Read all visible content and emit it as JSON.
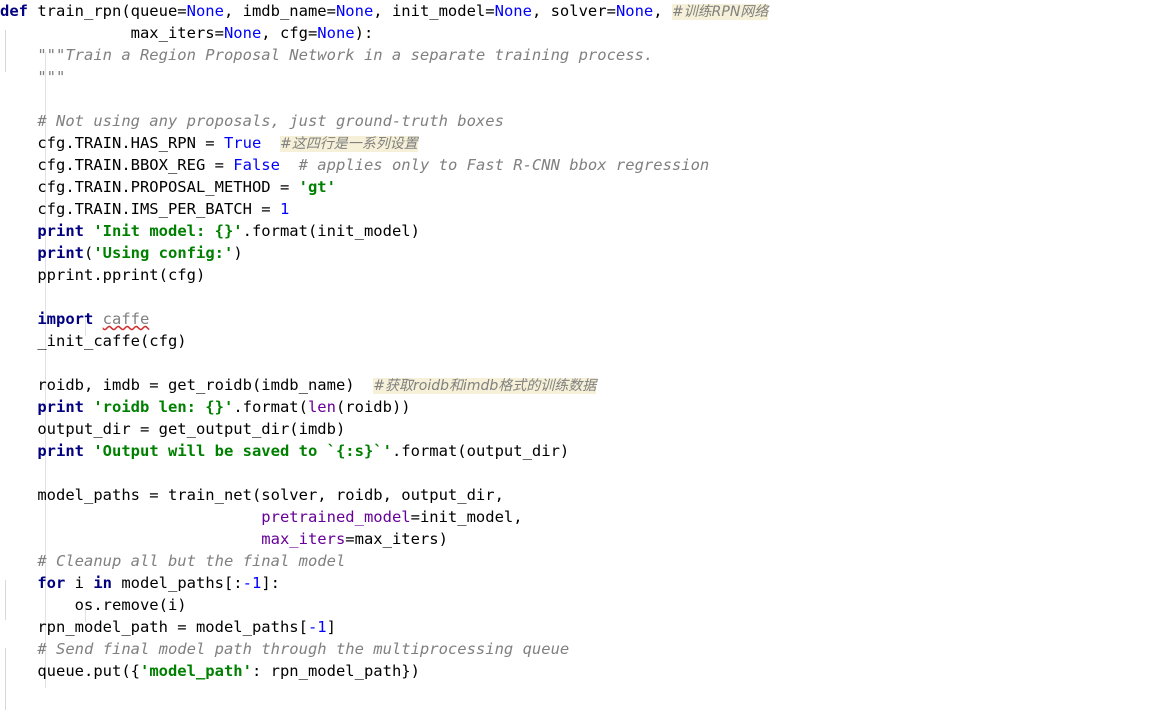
{
  "editor": {
    "language": "Python",
    "font_size_px": 15.5,
    "line_height_px": 22,
    "background": "#ffffff",
    "palette": {
      "default_text": "#000000",
      "keyword": "#000080",
      "number_constant": "#0000ff",
      "string": "#008000",
      "comment": "#808080",
      "keyword_argument": "#660099",
      "builtin": "#660099",
      "annotation_highlight": "#f5f0d7",
      "error_squiggle": "#d03030",
      "indent_guide": "#d8d8dc"
    }
  },
  "annotations": [
    {
      "text": "#训练RPN网络",
      "line": 1
    },
    {
      "text": "#这四行是一系列设置",
      "line": 8
    },
    {
      "text": "#获取roidb和imdb格式的训练数据",
      "line": 19
    }
  ],
  "code": {
    "function_name": "train_rpn",
    "signature_params": [
      "queue=None",
      "imdb_name=None",
      "init_model=None",
      "solver=None",
      "max_iters=None",
      "cfg=None"
    ],
    "docstring": "\"\"\"Train a Region Proposal Network in a separate training process.",
    "docstring_close": "\"\"\"",
    "lines": [
      {
        "n": 1,
        "tokens": [
          {
            "t": "def ",
            "c": "kw"
          },
          {
            "t": "train_rpn(queue=",
            "c": "ident"
          },
          {
            "t": "None",
            "c": "num"
          },
          {
            "t": ", imdb_name=",
            "c": "ident"
          },
          {
            "t": "None",
            "c": "num"
          },
          {
            "t": ", init_model=",
            "c": "ident"
          },
          {
            "t": "None",
            "c": "num"
          },
          {
            "t": ", solver=",
            "c": "ident"
          },
          {
            "t": "None",
            "c": "num"
          },
          {
            "t": ", ",
            "c": "ident"
          },
          {
            "t": "#训练RPN网络",
            "c": "cmt-hl"
          }
        ]
      },
      {
        "n": 2,
        "tokens": [
          {
            "t": "              max_iters=",
            "c": "ident"
          },
          {
            "t": "None",
            "c": "num"
          },
          {
            "t": ", cfg=",
            "c": "ident"
          },
          {
            "t": "None",
            "c": "num"
          },
          {
            "t": "):",
            "c": "ident"
          }
        ]
      },
      {
        "n": 3,
        "tokens": [
          {
            "t": "    \"\"\"Train a Region Proposal Network in a separate training process.",
            "c": "doc"
          }
        ]
      },
      {
        "n": 4,
        "tokens": [
          {
            "t": "    \"\"\"",
            "c": "doc"
          }
        ]
      },
      {
        "n": 5,
        "tokens": [
          {
            "t": "",
            "c": "ident"
          }
        ]
      },
      {
        "n": 6,
        "tokens": [
          {
            "t": "    # Not using any proposals, just ground-truth boxes",
            "c": "cmt"
          }
        ]
      },
      {
        "n": 7,
        "tokens": [
          {
            "t": "    cfg.TRAIN.HAS_RPN = ",
            "c": "ident"
          },
          {
            "t": "True",
            "c": "num"
          },
          {
            "t": "  ",
            "c": "ident"
          },
          {
            "t": "#这四行是一系列设置",
            "c": "cmt-hl"
          }
        ]
      },
      {
        "n": 8,
        "tokens": [
          {
            "t": "    cfg.TRAIN.BBOX_REG = ",
            "c": "ident"
          },
          {
            "t": "False",
            "c": "num"
          },
          {
            "t": "  ",
            "c": "ident"
          },
          {
            "t": "# applies only to Fast R-CNN bbox regression",
            "c": "cmt"
          }
        ]
      },
      {
        "n": 9,
        "tokens": [
          {
            "t": "    cfg.TRAIN.PROPOSAL_METHOD = ",
            "c": "ident"
          },
          {
            "t": "'gt'",
            "c": "str"
          }
        ]
      },
      {
        "n": 10,
        "tokens": [
          {
            "t": "    cfg.TRAIN.IMS_PER_BATCH = ",
            "c": "ident"
          },
          {
            "t": "1",
            "c": "num"
          }
        ]
      },
      {
        "n": 11,
        "tokens": [
          {
            "t": "    print ",
            "c": "kw"
          },
          {
            "t": "'Init model: {}'",
            "c": "str"
          },
          {
            "t": ".format(init_model)",
            "c": "ident"
          }
        ]
      },
      {
        "n": 12,
        "tokens": [
          {
            "t": "    print",
            "c": "kw"
          },
          {
            "t": "(",
            "c": "ident"
          },
          {
            "t": "'Using config:'",
            "c": "str"
          },
          {
            "t": ")",
            "c": "ident"
          }
        ]
      },
      {
        "n": 13,
        "tokens": [
          {
            "t": "    pprint.pprint(cfg)",
            "c": "ident"
          }
        ]
      },
      {
        "n": 14,
        "tokens": [
          {
            "t": "",
            "c": "ident"
          }
        ]
      },
      {
        "n": 15,
        "tokens": [
          {
            "t": "    import ",
            "c": "kw-import"
          },
          {
            "t": "caffe",
            "c": "unresolved"
          }
        ]
      },
      {
        "n": 16,
        "tokens": [
          {
            "t": "    _init_caffe(cfg)",
            "c": "ident"
          }
        ]
      },
      {
        "n": 17,
        "tokens": [
          {
            "t": "",
            "c": "ident"
          }
        ]
      },
      {
        "n": 18,
        "tokens": [
          {
            "t": "    roidb, imdb = get_roidb(imdb_name)",
            "c": "ident"
          },
          {
            "t": "  ",
            "c": "ident"
          },
          {
            "t": "#获取roidb和imdb格式的训练数据",
            "c": "cmt-hl"
          }
        ]
      },
      {
        "n": 19,
        "tokens": [
          {
            "t": "    print ",
            "c": "kw"
          },
          {
            "t": "'roidb len: {}'",
            "c": "str"
          },
          {
            "t": ".format(",
            "c": "ident"
          },
          {
            "t": "len",
            "c": "builtin"
          },
          {
            "t": "(roidb))",
            "c": "ident"
          }
        ]
      },
      {
        "n": 20,
        "tokens": [
          {
            "t": "    output_dir = get_output_dir(imdb)",
            "c": "ident"
          }
        ]
      },
      {
        "n": 21,
        "tokens": [
          {
            "t": "    print ",
            "c": "kw"
          },
          {
            "t": "'Output will be saved to `{:s}`'",
            "c": "str"
          },
          {
            "t": ".format(output_dir)",
            "c": "ident"
          }
        ]
      },
      {
        "n": 22,
        "tokens": [
          {
            "t": "",
            "c": "ident"
          }
        ]
      },
      {
        "n": 23,
        "tokens": [
          {
            "t": "    model_paths = train_net(solver, roidb, output_dir,",
            "c": "ident"
          }
        ]
      },
      {
        "n": 24,
        "tokens": [
          {
            "t": "                            ",
            "c": "ident"
          },
          {
            "t": "pretrained_model",
            "c": "kwarg"
          },
          {
            "t": "=init_model,",
            "c": "ident"
          }
        ]
      },
      {
        "n": 25,
        "tokens": [
          {
            "t": "                            ",
            "c": "ident"
          },
          {
            "t": "max_iters",
            "c": "kwarg"
          },
          {
            "t": "=max_iters)",
            "c": "ident"
          }
        ]
      },
      {
        "n": 26,
        "tokens": [
          {
            "t": "    # Cleanup all but the final model",
            "c": "cmt"
          }
        ]
      },
      {
        "n": 27,
        "tokens": [
          {
            "t": "    for ",
            "c": "kw"
          },
          {
            "t": "i ",
            "c": "ident"
          },
          {
            "t": "in ",
            "c": "kw"
          },
          {
            "t": "model_paths[:",
            "c": "ident"
          },
          {
            "t": "-1",
            "c": "num"
          },
          {
            "t": "]:",
            "c": "ident"
          }
        ]
      },
      {
        "n": 28,
        "tokens": [
          {
            "t": "        os.remove(i)",
            "c": "ident"
          }
        ]
      },
      {
        "n": 29,
        "tokens": [
          {
            "t": "    rpn_model_path = model_paths[",
            "c": "ident"
          },
          {
            "t": "-1",
            "c": "num"
          },
          {
            "t": "]",
            "c": "ident"
          }
        ]
      },
      {
        "n": 30,
        "tokens": [
          {
            "t": "    # Send final model path through the multiprocessing queue",
            "c": "cmt"
          }
        ]
      },
      {
        "n": 31,
        "tokens": [
          {
            "t": "    queue.put({",
            "c": "ident"
          },
          {
            "t": "'model_path'",
            "c": "str"
          },
          {
            "t": ": rpn_model_path})",
            "c": "ident"
          }
        ]
      }
    ]
  }
}
